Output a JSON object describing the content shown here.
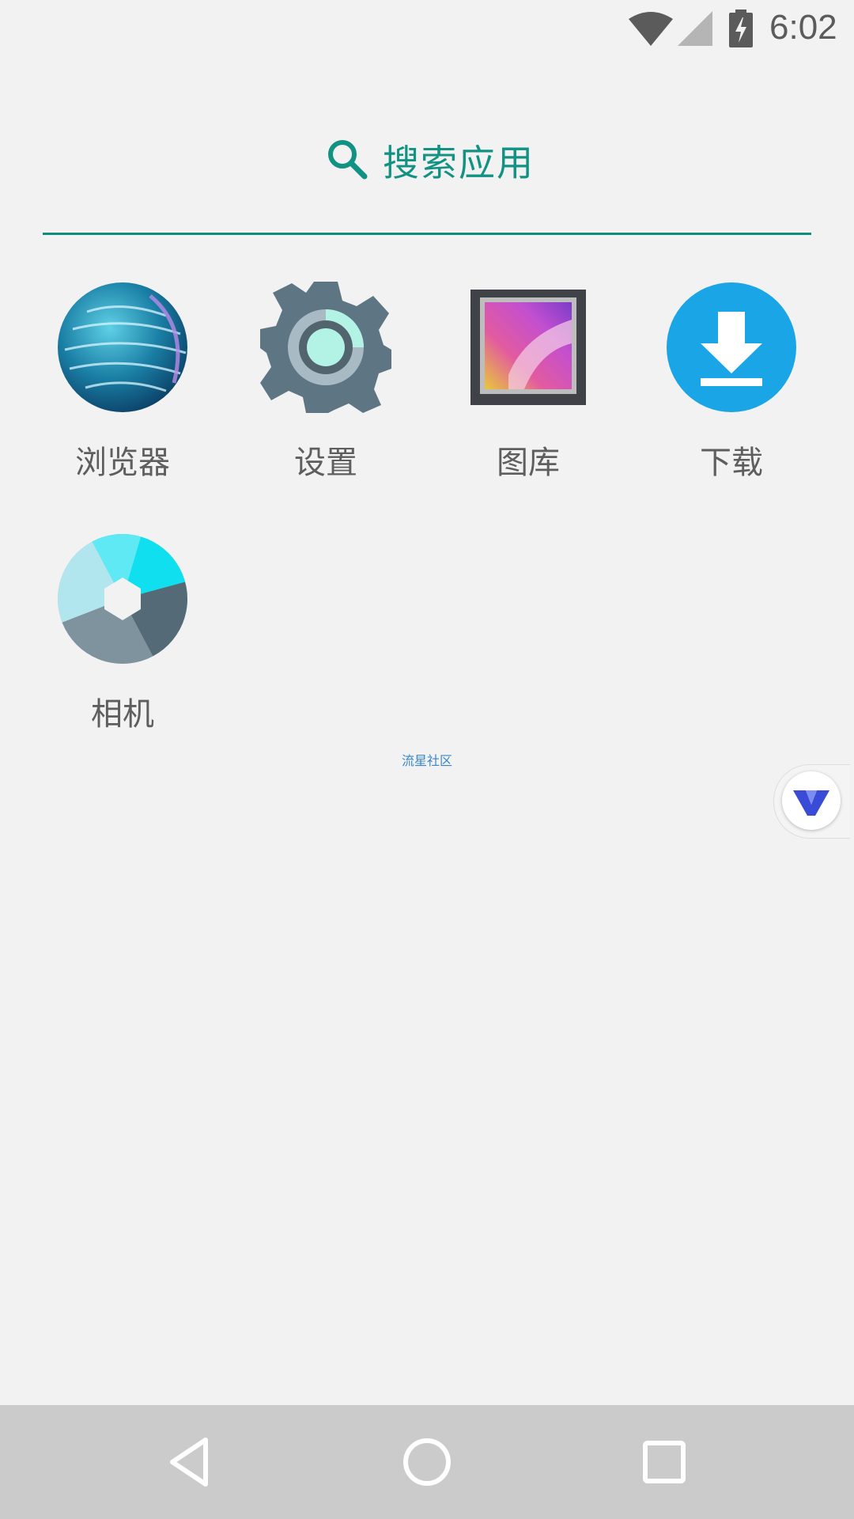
{
  "status_bar": {
    "time": "6:02",
    "icons": [
      "wifi-icon",
      "cell-signal-icon",
      "battery-charging-icon"
    ]
  },
  "search": {
    "label": "搜索应用",
    "icon": "search-icon",
    "accent_color": "#108d7f"
  },
  "apps": [
    {
      "label": "浏览器",
      "icon": "browser-globe-icon"
    },
    {
      "label": "设置",
      "icon": "settings-gear-icon"
    },
    {
      "label": "图库",
      "icon": "gallery-icon"
    },
    {
      "label": "下载",
      "icon": "download-icon"
    },
    {
      "label": "相机",
      "icon": "camera-aperture-icon"
    }
  ],
  "watermark": "流星社区",
  "floating_badge": {
    "icon": "v-logo-icon"
  },
  "nav_bar": {
    "buttons": [
      "back-icon",
      "home-icon",
      "recents-icon"
    ]
  }
}
